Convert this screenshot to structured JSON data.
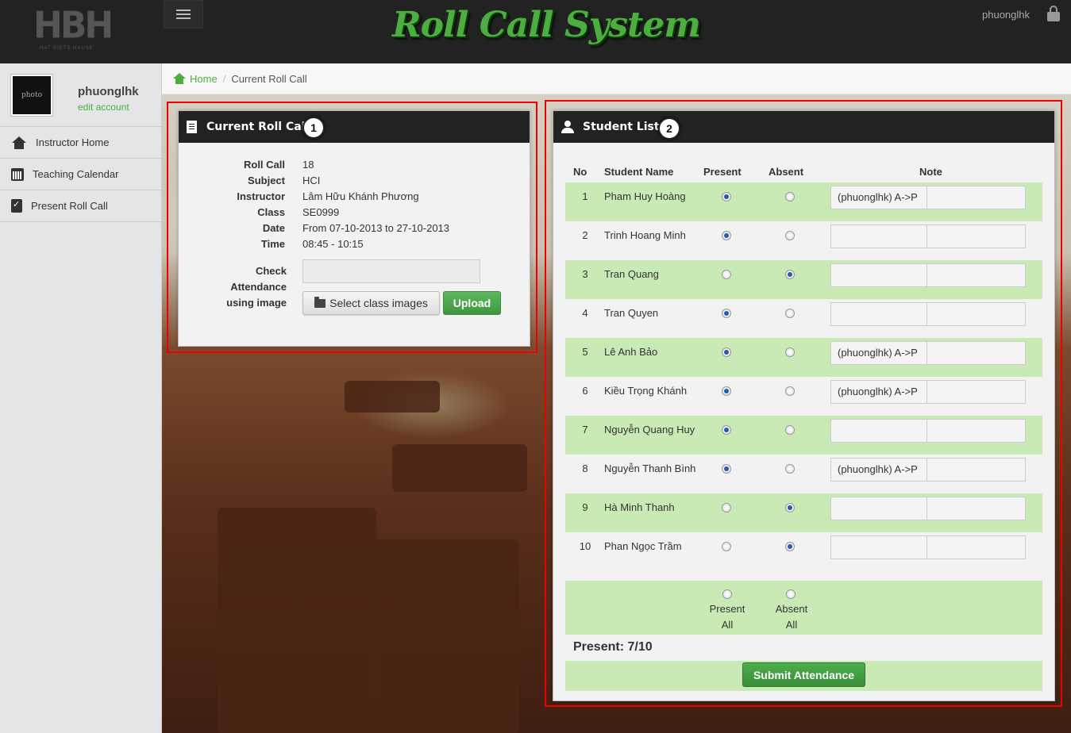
{
  "header": {
    "logo_text": "HBH",
    "logo_subtext": "HAT BIETS HAUSE",
    "app_title": "Roll Call System",
    "username": "phuonglhk"
  },
  "sidebar": {
    "avatar_text": "photo",
    "profile_name": "phuonglhk",
    "edit_account": "edit account",
    "items": [
      {
        "label": "Instructor Home",
        "icon": "home-icon"
      },
      {
        "label": "Teaching Calendar",
        "icon": "calendar-icon"
      },
      {
        "label": "Present Roll Call",
        "icon": "checklist-icon"
      }
    ]
  },
  "breadcrumb": {
    "home": "Home",
    "separator": "/",
    "current": "Current Roll Call"
  },
  "annotations": [
    "1",
    "2"
  ],
  "roll_call": {
    "title": "Current Roll Call",
    "fields": [
      {
        "label": "Roll Call",
        "value": "18"
      },
      {
        "label": "Subject",
        "value": "HCI"
      },
      {
        "label": "Instructor",
        "value": "Lâm Hữu Khánh Phương"
      },
      {
        "label": "Class",
        "value": "SE0999"
      },
      {
        "label": "Date",
        "value": "From 07-10-2013 to 27-10-2013"
      },
      {
        "label": "Time",
        "value": "08:45 - 10:15"
      }
    ],
    "check_label_1": "Check",
    "check_label_2": "Attendance",
    "check_label_3": "using image",
    "select_button": "Select class images",
    "upload_button": "Upload"
  },
  "student_list": {
    "title": "Student List",
    "columns": {
      "no": "No",
      "name": "Student Name",
      "present": "Present",
      "absent": "Absent",
      "note": "Note"
    },
    "students": [
      {
        "no": "1",
        "name": "Pham Huy Hoàng",
        "present": true,
        "note": "(phuonglhk) A->P"
      },
      {
        "no": "2",
        "name": "Trinh Hoang Minh",
        "present": true,
        "note": ""
      },
      {
        "no": "3",
        "name": "Tran Quang",
        "present": false,
        "note": ""
      },
      {
        "no": "4",
        "name": "Tran Quyen",
        "present": true,
        "note": ""
      },
      {
        "no": "5",
        "name": "Lê Anh Bảo",
        "present": true,
        "note": "(phuonglhk) A->P"
      },
      {
        "no": "6",
        "name": "Kiều Trọng Khánh",
        "present": true,
        "note": "(phuonglhk) A->P"
      },
      {
        "no": "7",
        "name": "Nguyễn Quang Huy",
        "present": true,
        "note": ""
      },
      {
        "no": "8",
        "name": "Nguyễn Thanh Bình",
        "present": true,
        "note": "(phuonglhk) A->P"
      },
      {
        "no": "9",
        "name": "Hà Minh Thanh",
        "present": false,
        "note": ""
      },
      {
        "no": "10",
        "name": "Phan Ngọc Trầm",
        "present": false,
        "note": ""
      }
    ],
    "present_all_1": "Present",
    "present_all_2": "All",
    "absent_all_1": "Absent",
    "absent_all_2": "All",
    "present_count": "Present: 7/10",
    "submit_button": "Submit Attendance"
  },
  "colors": {
    "accent": "#4cae3f",
    "row_highlight": "#c9eab4",
    "annotation_frame": "#ee0000",
    "header_bg": "#222222"
  }
}
